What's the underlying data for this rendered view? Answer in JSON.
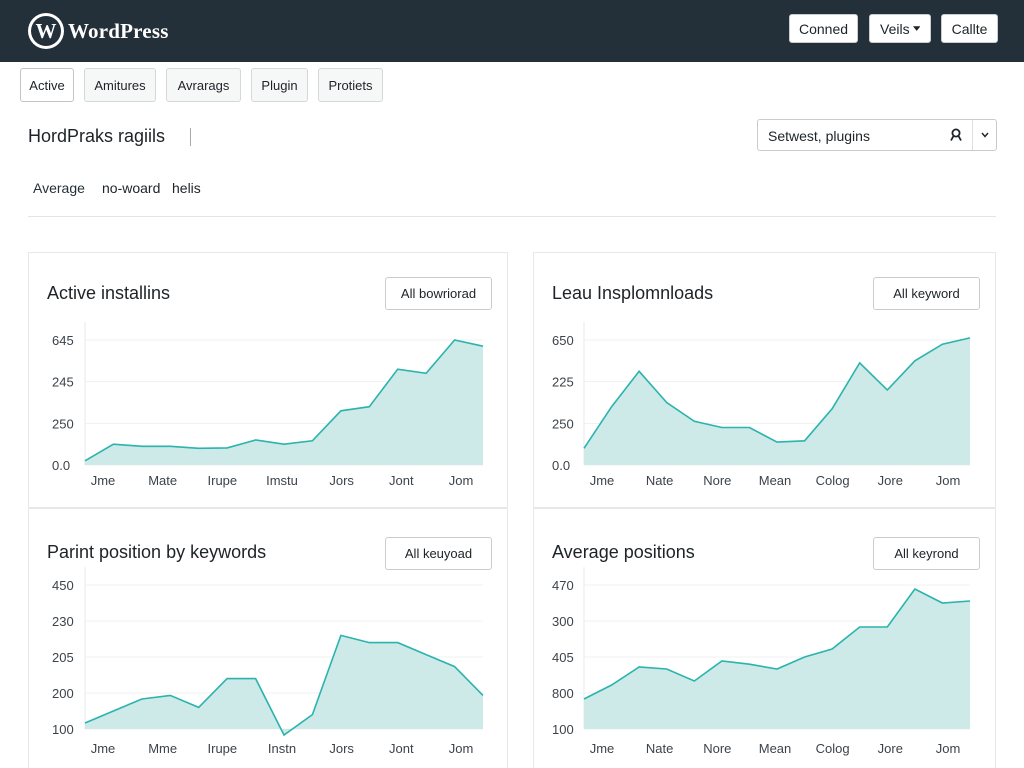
{
  "header": {
    "logo_letter": "W",
    "logo_text": "WordPress",
    "buttons": [
      "Conned",
      "Veils",
      "Callte"
    ]
  },
  "tabs": [
    "Active",
    "Amitures",
    "Avrarags",
    "Plugin",
    "Protiets"
  ],
  "page": {
    "title": "HordPraks ragiils",
    "search_value": "Setwest, plugins",
    "subtabs": [
      "Average",
      "no-woard",
      "helis"
    ]
  },
  "colors": {
    "topbar": "#23303a",
    "line": "#2bb3ad",
    "fill": "#cde9e8"
  },
  "icons": {
    "search": "search-icon",
    "chevron": "chevron-down-icon",
    "dropdown": "caret-down-icon"
  },
  "chart_data": [
    {
      "type": "area",
      "title": "Active installins",
      "button": "All bowriorad",
      "categories": [
        "Jme",
        "Mate",
        "Irupe",
        "Imstu",
        "Jors",
        "Jont",
        "Jom"
      ],
      "y_ticks": [
        "0.0",
        "250",
        "245",
        "645"
      ],
      "values": [
        0.1,
        0.5,
        0.45,
        0.45,
        0.4,
        0.41,
        0.6,
        0.5,
        0.58,
        1.3,
        1.4,
        2.3,
        2.2,
        3.0,
        2.85
      ]
    },
    {
      "type": "area",
      "title": "Leau Insplomnloads",
      "button": "All keyword",
      "categories": [
        "Jme",
        "Nate",
        "Nore",
        "Mean",
        "Colog",
        "Jore",
        "Jom"
      ],
      "y_ticks": [
        "0.0",
        "250",
        "225",
        "650"
      ],
      "values": [
        0.4,
        1.4,
        2.25,
        1.5,
        1.05,
        0.9,
        0.9,
        0.55,
        0.58,
        1.35,
        2.45,
        1.8,
        2.5,
        2.9,
        3.05
      ]
    },
    {
      "type": "area",
      "title": "Parint position by keywords",
      "button": "All keuyoad",
      "categories": [
        "Jme",
        "Mme",
        "Irupe",
        "Instn",
        "Jors",
        "Jont",
        "Jom"
      ],
      "y_ticks": [
        "100",
        "200",
        "205",
        "230",
        "450"
      ],
      "values": [
        0.05,
        0.15,
        0.25,
        0.28,
        0.18,
        0.42,
        0.42,
        -0.05,
        0.12,
        0.78,
        0.72,
        0.72,
        0.62,
        0.52,
        0.28
      ]
    },
    {
      "type": "area",
      "title": "Average positions",
      "button": "All keyrond",
      "categories": [
        "Jme",
        "Nate",
        "Nore",
        "Mean",
        "Colog",
        "Jore",
        "Jom"
      ],
      "y_ticks": [
        "100",
        "800",
        "405",
        "300",
        "470"
      ],
      "values": [
        0.75,
        1.1,
        1.55,
        1.5,
        1.2,
        1.7,
        1.62,
        1.5,
        1.8,
        2.0,
        2.55,
        2.55,
        3.5,
        3.15,
        3.2
      ]
    }
  ]
}
